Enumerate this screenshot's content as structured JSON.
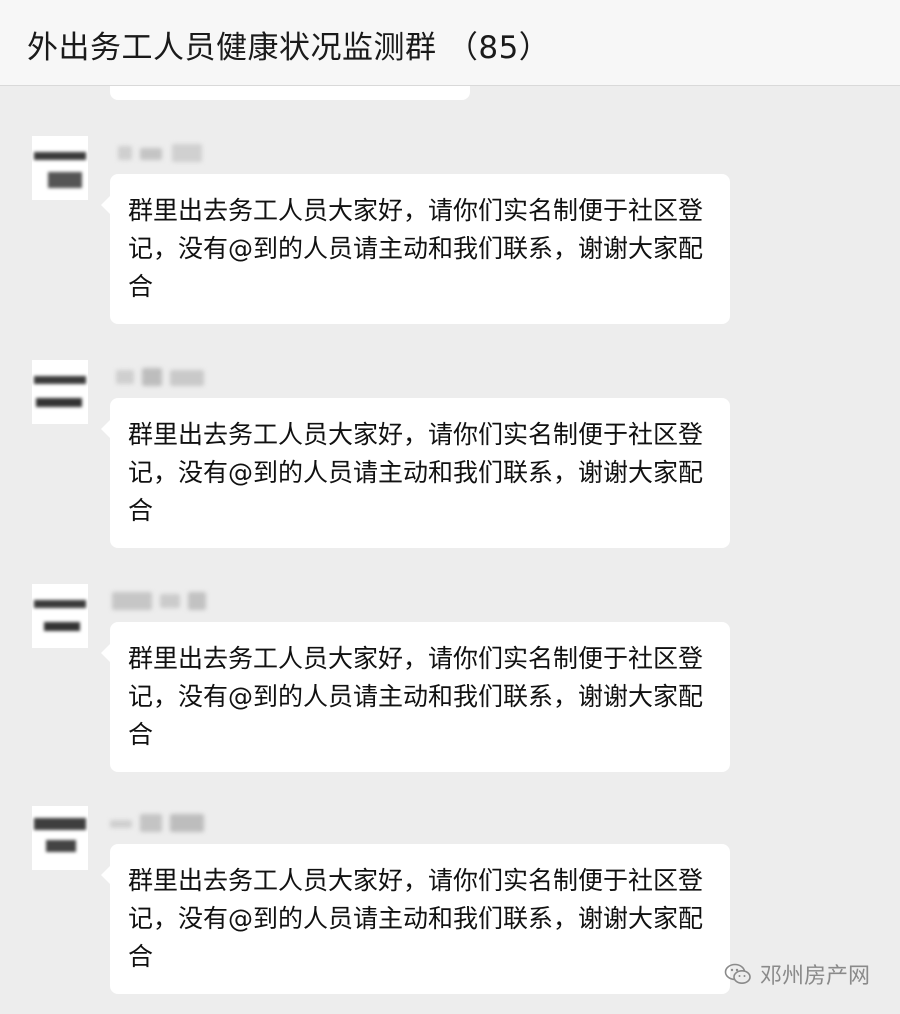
{
  "header": {
    "title": "外出务工人员健康状况监测群 （85）"
  },
  "messages": [
    {
      "sender_name": "",
      "text": "群里出去务工人员大家好，请你们实名制便于社区登记，没有@到的人员请主动和我们联系，谢谢大家配合"
    },
    {
      "sender_name": "",
      "text": "群里出去务工人员大家好，请你们实名制便于社区登记，没有@到的人员请主动和我们联系，谢谢大家配合"
    },
    {
      "sender_name": "",
      "text": "群里出去务工人员大家好，请你们实名制便于社区登记，没有@到的人员请主动和我们联系，谢谢大家配合"
    },
    {
      "sender_name": "",
      "text": "群里出去务工人员大家好，请你们实名制便于社区登记，没有@到的人员请主动和我们联系，谢谢大家配合"
    }
  ],
  "watermark": {
    "text": "邓州房产网",
    "icon": "wechat-icon"
  },
  "colors": {
    "background": "#ededed",
    "header": "#f7f7f7",
    "bubble": "#ffffff",
    "text": "#111111"
  }
}
